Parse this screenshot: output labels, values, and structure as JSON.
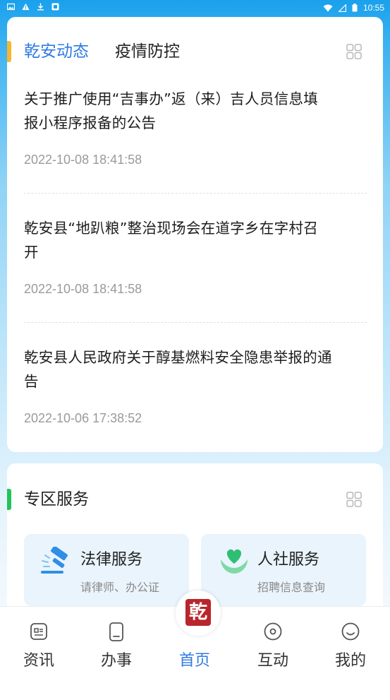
{
  "status_bar": {
    "time": "10:55",
    "left_icons": [
      "image-icon",
      "warning-icon",
      "download-icon",
      "app-icon"
    ],
    "right_icons": [
      "wifi-icon",
      "signal-icon",
      "battery-icon"
    ]
  },
  "news_card": {
    "tabs": [
      {
        "label": "乾安动态",
        "active": true
      },
      {
        "label": "疫情防控",
        "active": false
      }
    ],
    "accent_color": "#f5b731",
    "items": [
      {
        "title_line1": "关于推广使用“吉事办”返（来）吉人员信息填",
        "title_line2": "报小程序报备的公告",
        "date": "2022-10-08 18:41:58"
      },
      {
        "title_line1": "乾安县“地趴粮”整治现场会在道字乡在字村召",
        "title_line2": "开",
        "date": "2022-10-08 18:41:58"
      },
      {
        "title_line1": "乾安县人民政府关于醇基燃料安全隐患举报的通",
        "title_line2": "告",
        "date": "2022-10-06 17:38:52"
      }
    ]
  },
  "service_card": {
    "title": "专区服务",
    "accent_color": "#23c35a",
    "services": [
      {
        "name": "法律服务",
        "sub": "请律师、办公证",
        "icon": "gavel-icon"
      },
      {
        "name": "人社服务",
        "sub": "招聘信息查询",
        "icon": "heart-hands-icon"
      }
    ]
  },
  "tabbar": {
    "items": [
      {
        "label": "资讯",
        "icon": "news-icon",
        "active": false
      },
      {
        "label": "办事",
        "icon": "phone-icon",
        "active": false
      },
      {
        "label": "首页",
        "icon": "seal-icon",
        "active": true
      },
      {
        "label": "互动",
        "icon": "chat-icon",
        "active": false
      },
      {
        "label": "我的",
        "icon": "smile-icon",
        "active": false
      }
    ],
    "seal_char": "乾",
    "active_color": "#2f7be3"
  }
}
